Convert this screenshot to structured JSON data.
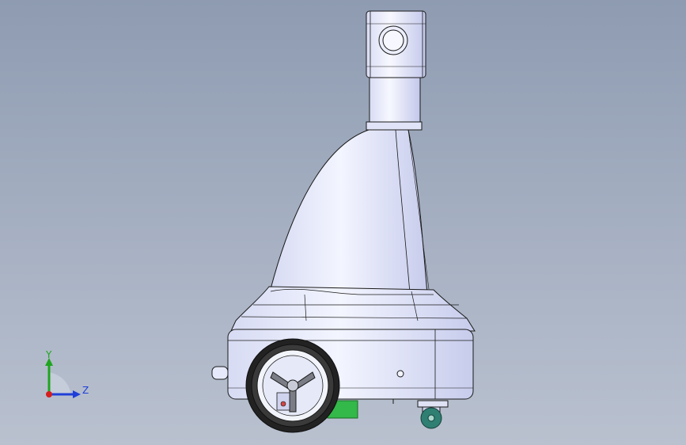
{
  "triad": {
    "y_label": "Y",
    "z_label": "Z",
    "colors": {
      "y_axis": "#1fa51f",
      "z_axis": "#1f3fd8",
      "x_axis": "#d41f1f"
    }
  },
  "model": {
    "body_color": "#e8ebfb",
    "edge_color": "#1a1a1a",
    "tire_color": "#222222",
    "hub_color": "#f2f4fb",
    "green_part_color": "#33b84a",
    "caster_color": "#2f7f73"
  }
}
